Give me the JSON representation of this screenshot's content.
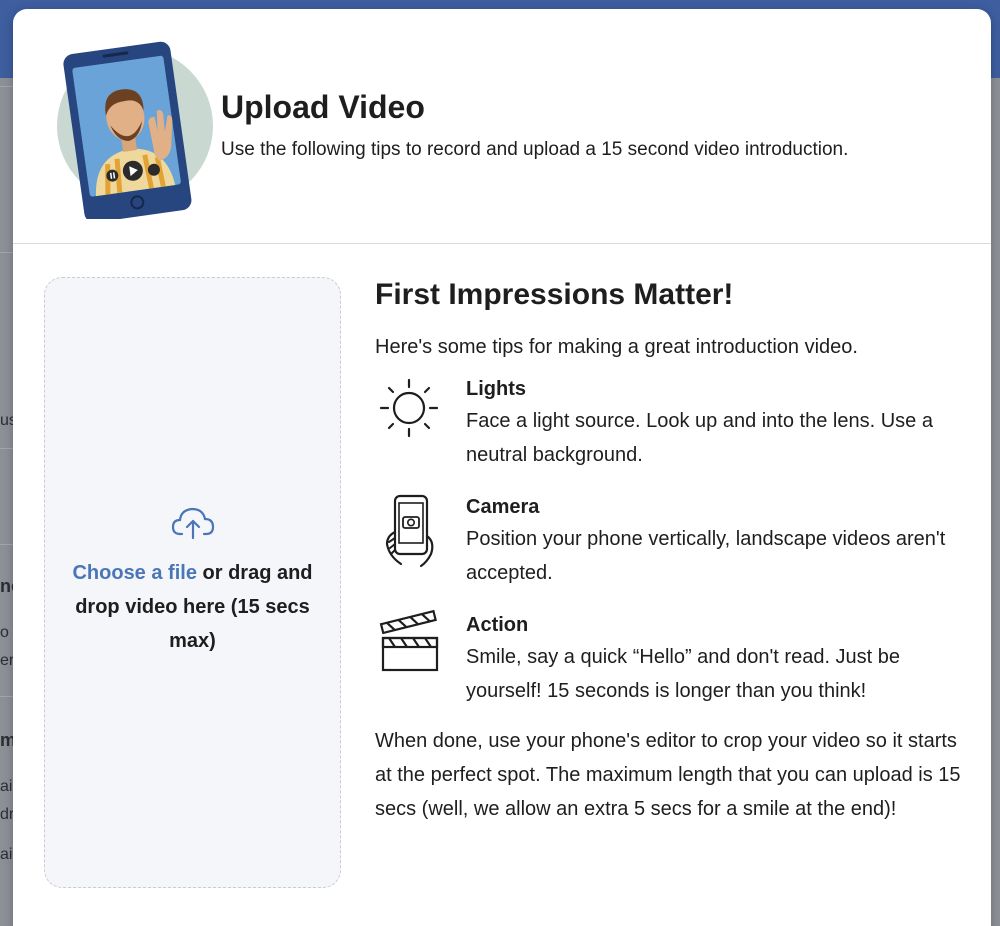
{
  "modal": {
    "title": "Upload Video",
    "subtitle": "Use the following tips to record and upload a 15 second video introduction."
  },
  "dropzone": {
    "link_label": "Choose a file",
    "text": " or drag and drop video here (15 secs max)"
  },
  "tips": {
    "heading": "First Impressions Matter!",
    "intro": "Here's some tips for making a great introduction video.",
    "items": [
      {
        "icon": "sun-icon",
        "title": "Lights",
        "description": "Face a light source. Look up and into the lens. Use a neutral background."
      },
      {
        "icon": "phone-camera-icon",
        "title": "Camera",
        "description": "Position your phone vertically, landscape videos aren't accepted."
      },
      {
        "icon": "clapperboard-icon",
        "title": "Action",
        "description": "Smile, say a quick “Hello” and don't read. Just be yourself! 15 seconds is longer than you think!"
      }
    ],
    "outro": "When done, use your phone's editor to crop your video so it starts at the perfect spot. The maximum length that you can upload is 15 secs (well, we allow an extra 5 secs for a smile at the end)!"
  },
  "background_page": {
    "fragments": [
      "us",
      "nc",
      "o",
      "er,",
      "m",
      "ai",
      "dr",
      "ai"
    ]
  },
  "colors": {
    "link": "#4a76b8",
    "dropzone_bg": "#f4f6f9",
    "topbar": "#3e5ea0"
  }
}
